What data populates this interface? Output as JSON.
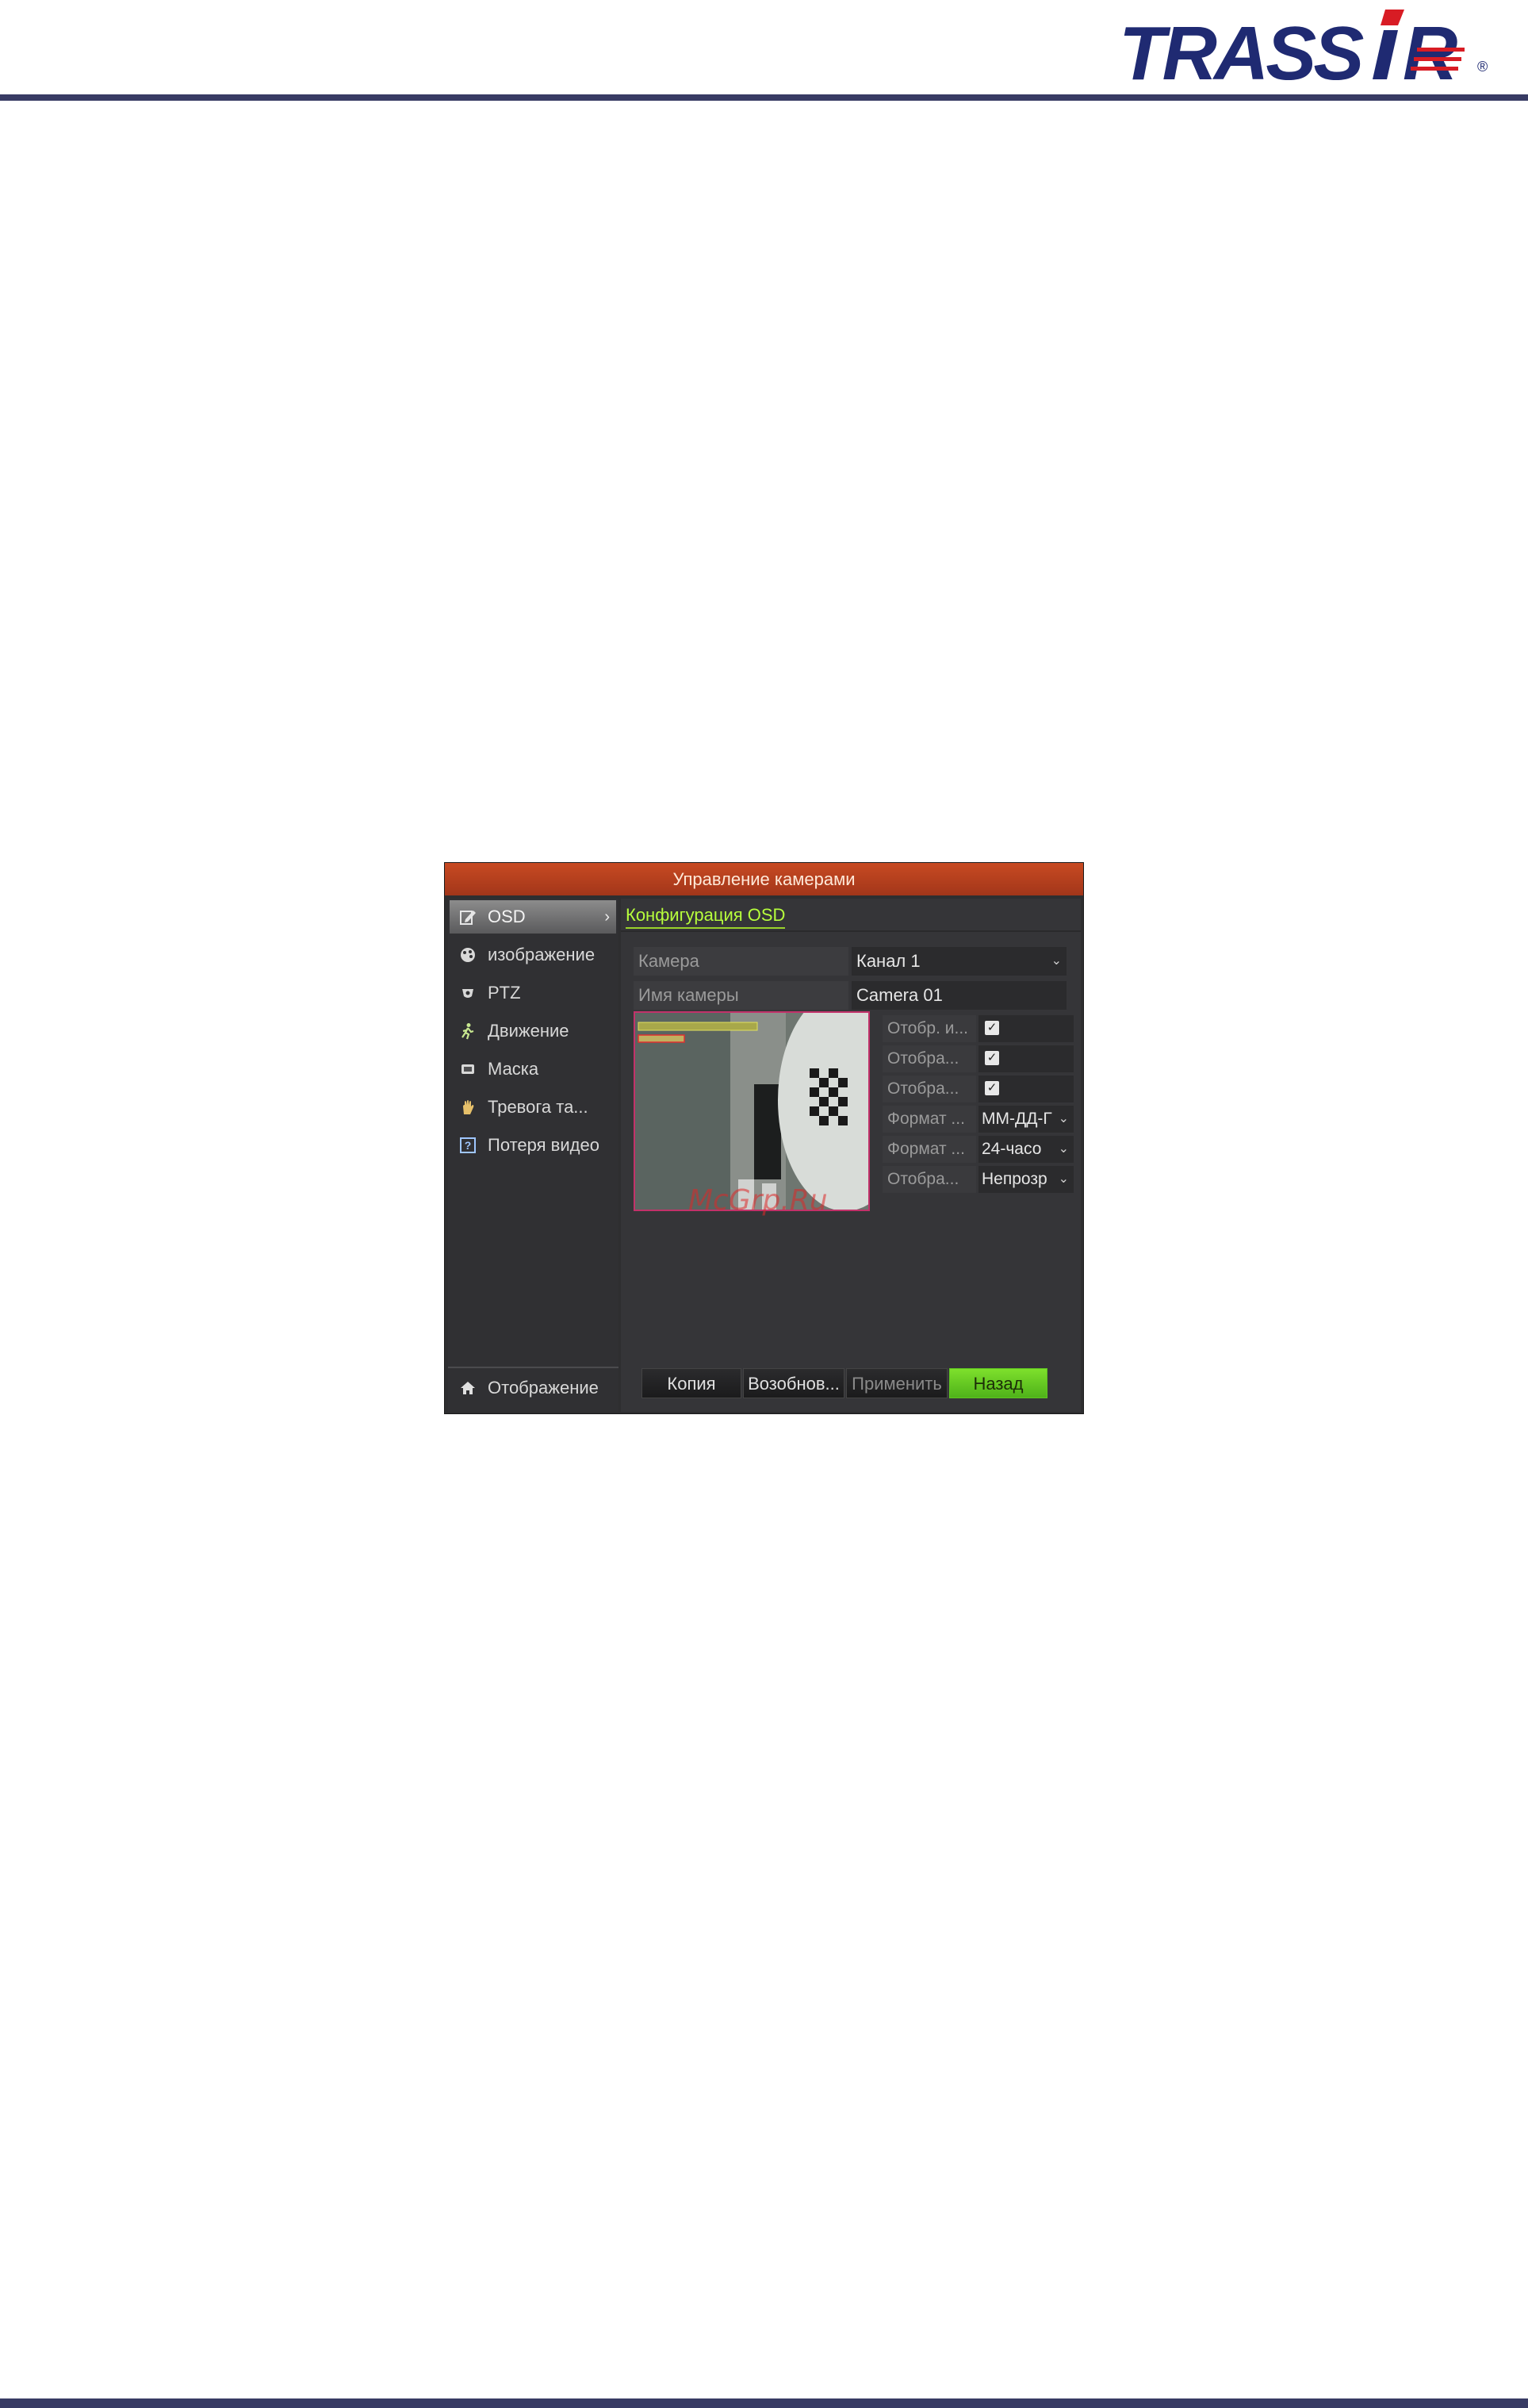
{
  "brand": {
    "name": "TRASSIR",
    "registered": "®",
    "color": "#1f2a72",
    "accent": "#d81c24"
  },
  "window": {
    "title": "Управление камерами",
    "title_color": "#b8401e"
  },
  "sidebar": {
    "items": [
      {
        "label": "OSD",
        "icon": "edit-icon",
        "active": true
      },
      {
        "label": "изображение",
        "icon": "palette-icon"
      },
      {
        "label": "PTZ",
        "icon": "ptz-camera-icon"
      },
      {
        "label": "Движение",
        "icon": "running-man-icon"
      },
      {
        "label": "Маска",
        "icon": "mask-icon"
      },
      {
        "label": "Тревога та...",
        "icon": "hand-icon"
      },
      {
        "label": "Потеря видео",
        "icon": "question-box-icon"
      }
    ],
    "footer": {
      "label": "Отображение",
      "icon": "home-icon"
    }
  },
  "main": {
    "section_title": "Конфигурация OSD",
    "camera": {
      "label": "Камера",
      "value": "Канал 1"
    },
    "camera_name": {
      "label": "Имя камеры",
      "value": "Camera 01"
    },
    "options": [
      {
        "label": "Отобр. и...",
        "type": "checkbox",
        "checked": true
      },
      {
        "label": "Отобра...",
        "type": "checkbox",
        "checked": true
      },
      {
        "label": "Отобра...",
        "type": "checkbox",
        "checked": true
      },
      {
        "label": "Формат ...",
        "type": "select",
        "value": "ММ-ДД-Г"
      },
      {
        "label": "Формат ...",
        "type": "select",
        "value": "24-часо"
      },
      {
        "label": "Отобра...",
        "type": "select",
        "value": "Непрозр"
      }
    ]
  },
  "buttons": {
    "copy": "Копия",
    "restore": "Возобнов...",
    "apply": "Применить",
    "back": "Назад"
  },
  "watermark": "McGrp.Ru",
  "accent_color": "#6cd424"
}
